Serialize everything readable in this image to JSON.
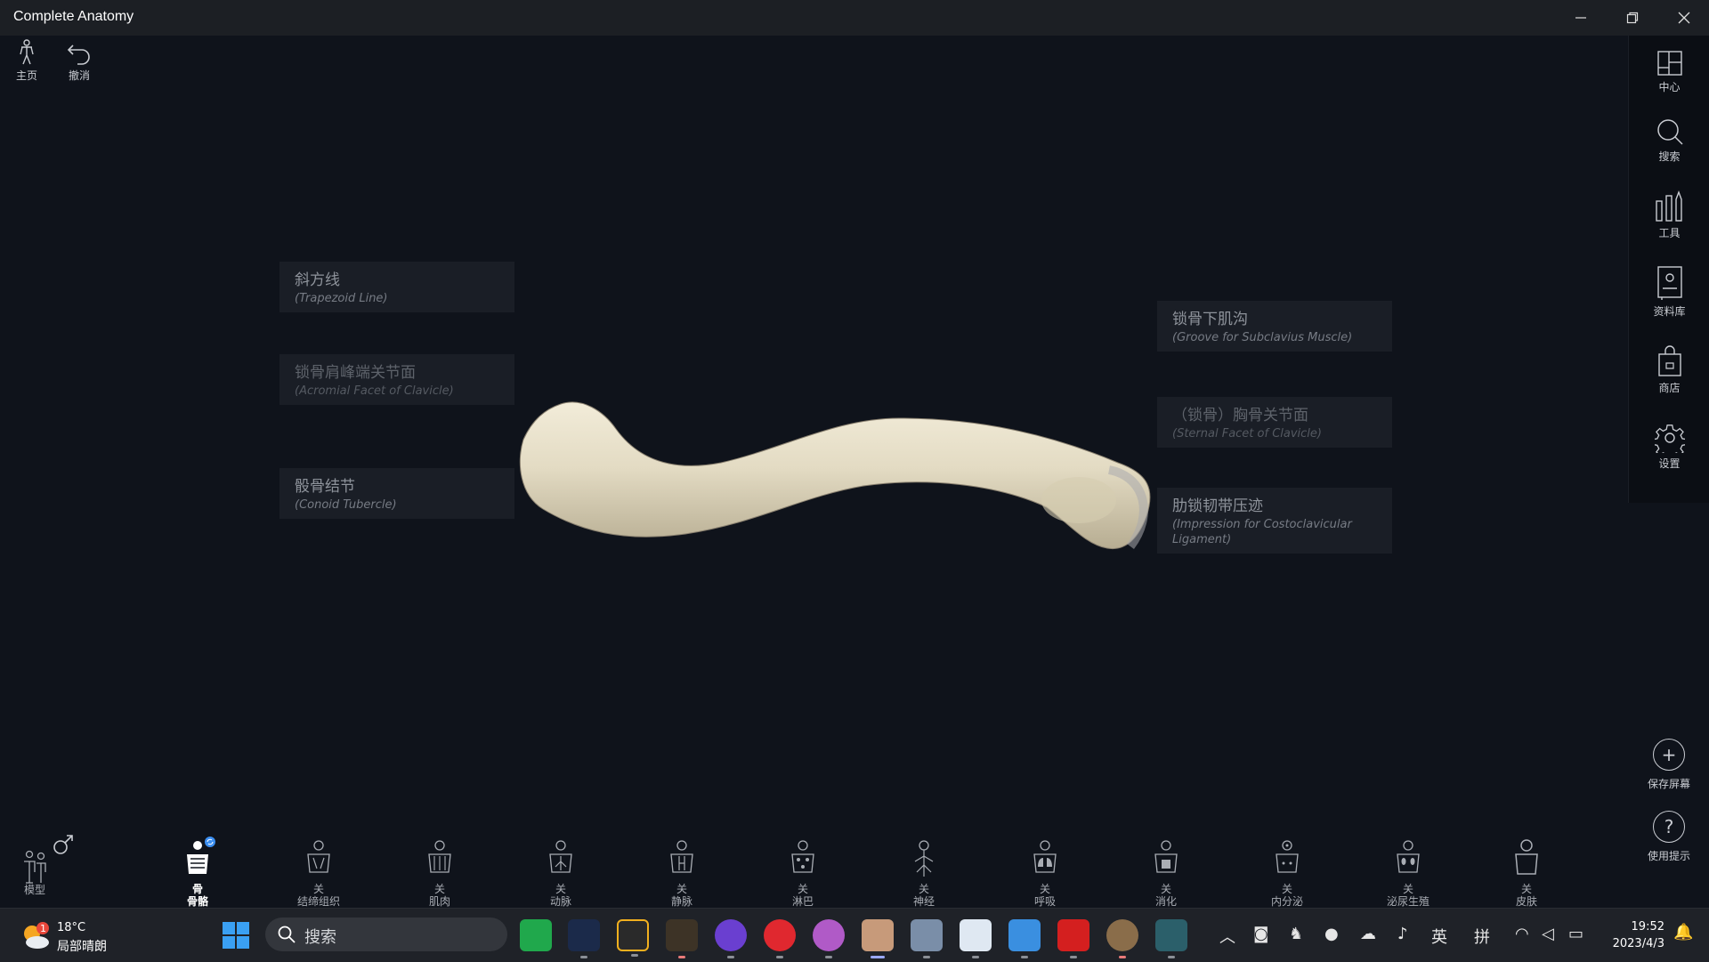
{
  "window": {
    "title": "Complete Anatomy"
  },
  "top_left": {
    "home_label": "主页",
    "undo_label": "撤消"
  },
  "right_sidebar": {
    "items": [
      {
        "icon": "layout-icon",
        "label": "中心"
      },
      {
        "icon": "search-icon",
        "label": "搜索"
      },
      {
        "icon": "tools-icon",
        "label": "工具"
      },
      {
        "icon": "library-icon",
        "label": "资料库"
      },
      {
        "icon": "shop-icon",
        "label": "商店"
      },
      {
        "icon": "gear-icon",
        "label": "设置"
      }
    ]
  },
  "labels": {
    "trapezoid": {
      "cn": "斜方线",
      "en": "(Trapezoid Line)"
    },
    "acromial": {
      "cn": "锁骨肩峰端关节面",
      "en": "(Acromial Facet of Clavicle)"
    },
    "conoid": {
      "cn": "骰骨结节",
      "en": "(Conoid Tubercle)"
    },
    "subclavius": {
      "cn": "锁骨下肌沟",
      "en": "(Groove for Subclavius Muscle)"
    },
    "sternal": {
      "cn": "（锁骨）胸骨关节面",
      "en": "(Sternal Facet of Clavicle)"
    },
    "costoclavicular": {
      "cn": "肋锁韧带压迹",
      "en": "(Impression for Costoclavicular Ligament)"
    }
  },
  "right_bottom": {
    "save_label": "保存屏幕",
    "help_label": "使用提示"
  },
  "systems_bar": {
    "model_label": "模型",
    "items": [
      {
        "status": "骨",
        "name": "骨骼",
        "active": true
      },
      {
        "status": "关",
        "name": "结缔组织"
      },
      {
        "status": "关",
        "name": "肌肉"
      },
      {
        "status": "关",
        "name": "动脉"
      },
      {
        "status": "关",
        "name": "静脉"
      },
      {
        "status": "关",
        "name": "淋巴"
      },
      {
        "status": "关",
        "name": "神经"
      },
      {
        "status": "关",
        "name": "呼吸"
      },
      {
        "status": "关",
        "name": "消化"
      },
      {
        "status": "关",
        "name": "内分泌"
      },
      {
        "status": "关",
        "name": "泌尿生殖"
      },
      {
        "status": "关",
        "name": "皮肤"
      }
    ]
  },
  "taskbar": {
    "weather_temp": "18°C",
    "weather_cond": "局部晴朗",
    "weather_badge": "1",
    "search_placeholder": "搜索",
    "ime_lang": "英",
    "ime_mode": "拼",
    "time": "19:52",
    "date": "2023/4/3",
    "colors": {
      "accent": "#3b8ef0",
      "bar": "#1f2228"
    }
  }
}
